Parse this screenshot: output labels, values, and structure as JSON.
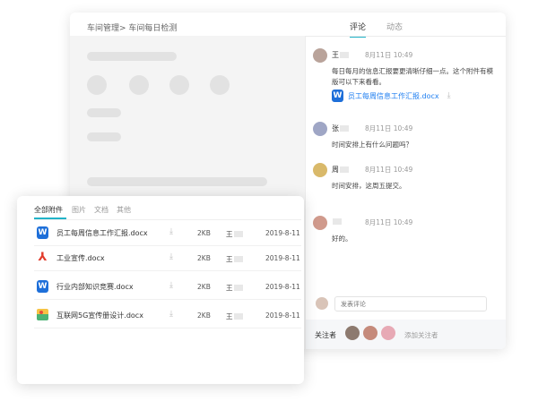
{
  "main": {
    "breadcrumb": "车间管理> 车间每日检测",
    "tabs": [
      {
        "label": "评论",
        "active": true
      },
      {
        "label": "动态",
        "active": false
      }
    ]
  },
  "comments": [
    {
      "name": "王",
      "time": "8月11日 10:49",
      "text": "每日每月的信息汇报要更清晰仔细一点。这个附件有模版可以下来看看。",
      "attachment": {
        "name": "员工每周信息工作汇报.docx",
        "icon": "word-icon"
      },
      "avatar_color": "#b9a39a"
    },
    {
      "name": "张",
      "time": "8月11日 10:49",
      "text": "时间安排上有什么问题吗？",
      "avatar_color": "#9fa6c5"
    },
    {
      "name": "周",
      "time": "8月11日 10:49",
      "text": "时间安排，这周五提交。",
      "avatar_color": "#d9b96a"
    },
    {
      "name": "",
      "time": "8月11日 10:49",
      "text": "好的。",
      "avatar_color": "#d09a8c"
    }
  ],
  "comment_input": {
    "placeholder": "发表评论"
  },
  "followers": {
    "label": "关注者",
    "add_label": "添加关注者",
    "avatars": [
      "#8d7a6f",
      "#c58a7b",
      "#e7a9b5"
    ]
  },
  "attachments_panel": {
    "tabs": [
      {
        "label": "全部附件",
        "active": true
      },
      {
        "label": "图片",
        "active": false
      },
      {
        "label": "文档",
        "active": false
      },
      {
        "label": "其他",
        "active": false
      }
    ],
    "files": [
      {
        "name": "员工每周信息工作汇报.docx",
        "icon": "word-icon",
        "size": "2KB",
        "owner": "王",
        "date": "2019-8-11"
      },
      {
        "name": "工业宣传.docx",
        "icon": "pdf-icon",
        "size": "2KB",
        "owner": "王",
        "date": "2019-8-11"
      },
      {
        "name": "行业内部知识竞赛.docx",
        "icon": "word-icon",
        "size": "2KB",
        "owner": "王",
        "date": "2019-8-11"
      },
      {
        "name": "互联网5G宣传册设计.docx",
        "icon": "image-icon",
        "size": "2KB",
        "owner": "王",
        "date": "2019-8-11"
      }
    ]
  },
  "colors": {
    "accent": "#21b3c8",
    "link": "#1e7ef0",
    "word": "#1e6fd9",
    "pdf": "#e23c2c"
  }
}
